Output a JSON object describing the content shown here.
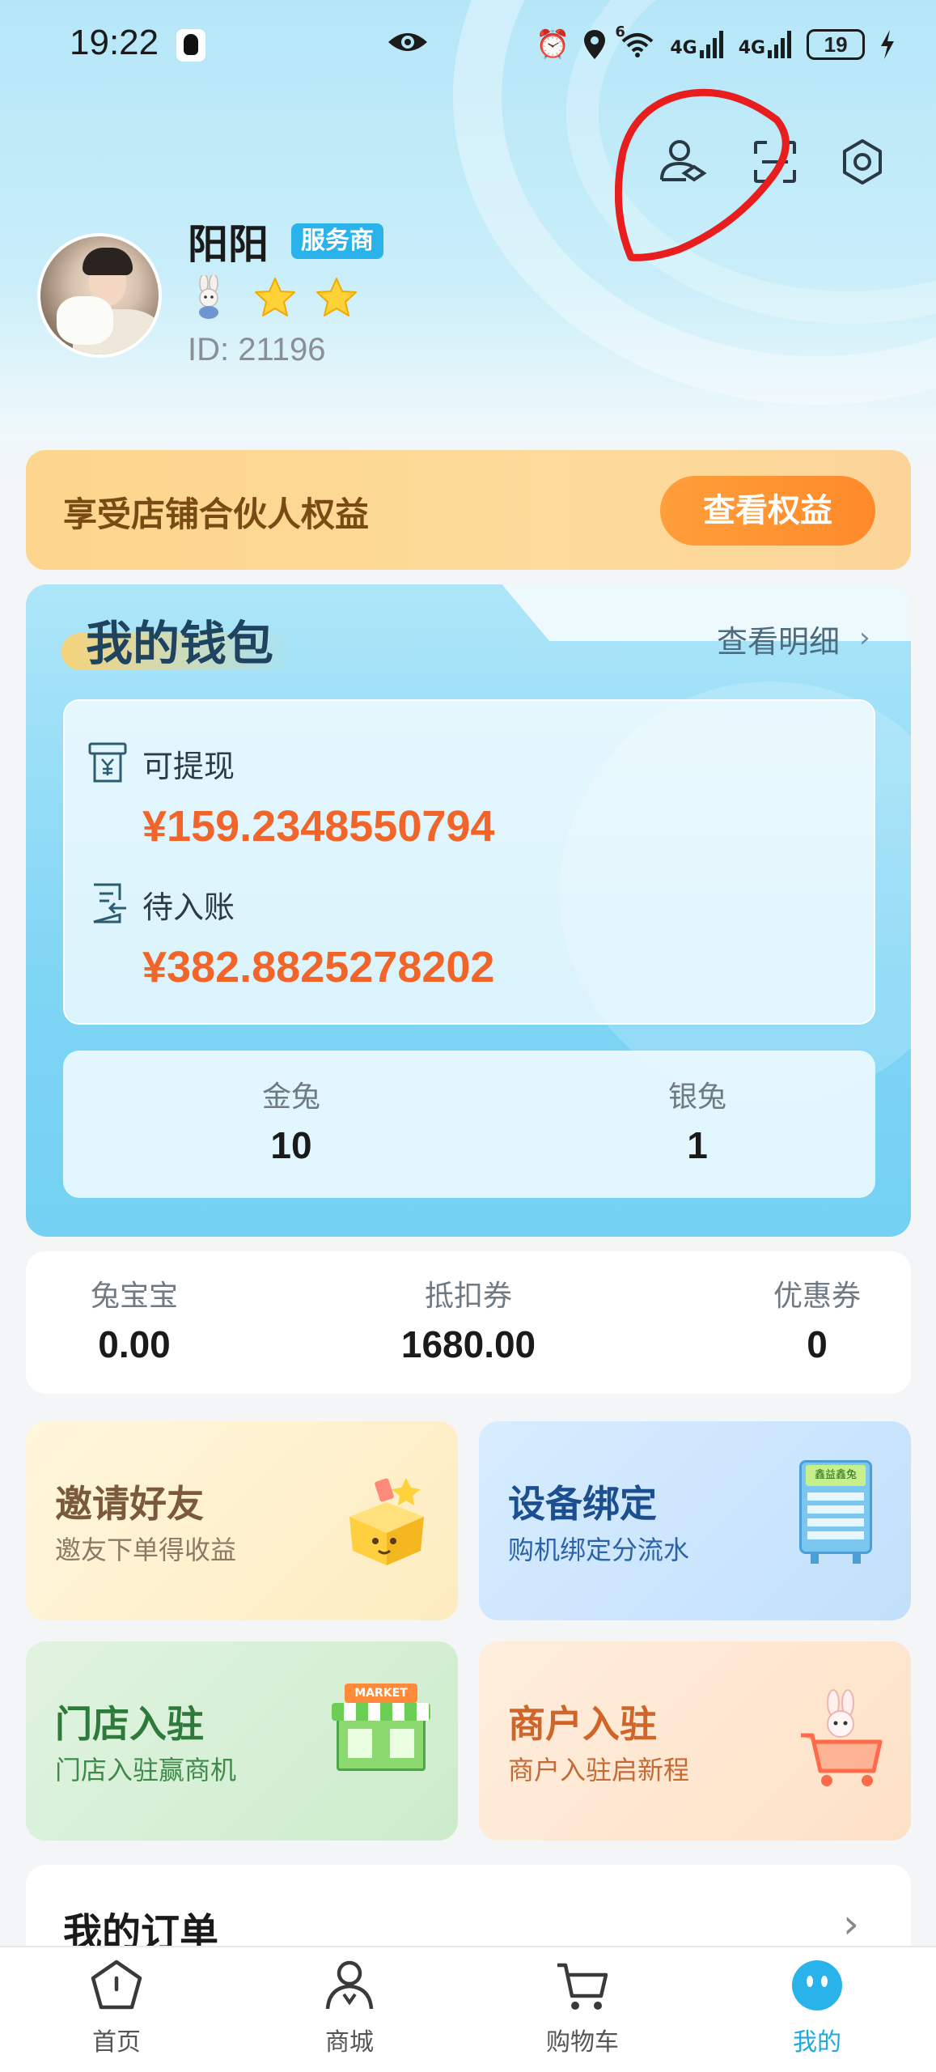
{
  "status_bar": {
    "time": "19:22",
    "icons": [
      "qq-icon",
      "eye-icon",
      "alarm-icon",
      "location-icon",
      "wifi-icon",
      "signal-icon",
      "signal-icon",
      "battery-icon",
      "charging-icon"
    ],
    "network_1": "4G",
    "network_2": "4G",
    "wifi_badge": "6",
    "battery": "19"
  },
  "header": {
    "icons": [
      "user-switch-icon",
      "scan-icon",
      "settings-icon"
    ],
    "annotation_color": "#e81d1d"
  },
  "profile": {
    "name": "阳阳",
    "role": "服务商",
    "level_icons": [
      "rabbit-icon",
      "star-icon",
      "star-icon"
    ],
    "id": "ID: 21196"
  },
  "partner_banner": {
    "text": "享受店铺合伙人权益",
    "button": "查看权益"
  },
  "wallet": {
    "title": "我的钱包",
    "detail_link": "查看明细",
    "withdrawable_label": "可提现",
    "withdrawable_amount": "¥159.2348550794",
    "pending_label": "待入账",
    "pending_amount": "¥382.8825278202",
    "gold_label": "金兔",
    "gold_value": "10",
    "silver_label": "银兔",
    "silver_value": "1"
  },
  "stats": {
    "tubaobao_label": "兔宝宝",
    "tubaobao_value": "0.00",
    "voucher_label": "抵扣券",
    "voucher_value": "1680.00",
    "coupon_label": "优惠券",
    "coupon_value": "0"
  },
  "tiles": {
    "invite_title": "邀请好友",
    "invite_sub": "邀友下单得收益",
    "device_title": "设备绑定",
    "device_sub": "购机绑定分流水",
    "device_screen": "鑫益鑫兔",
    "store_title": "门店入驻",
    "store_sub": "门店入驻赢商机",
    "store_sign": "MARKET",
    "merchant_title": "商户入驻",
    "merchant_sub": "商户入驻启新程"
  },
  "orders": {
    "title": "我的订单"
  },
  "bottom_nav": {
    "home": "首页",
    "mall": "商城",
    "cart": "购物车",
    "mine": "我的",
    "active": "mine"
  },
  "colors": {
    "accent": "#1fa9df",
    "amount": "#f1642a",
    "badge": "#29b3ea",
    "partner_button": "#ff9339"
  }
}
